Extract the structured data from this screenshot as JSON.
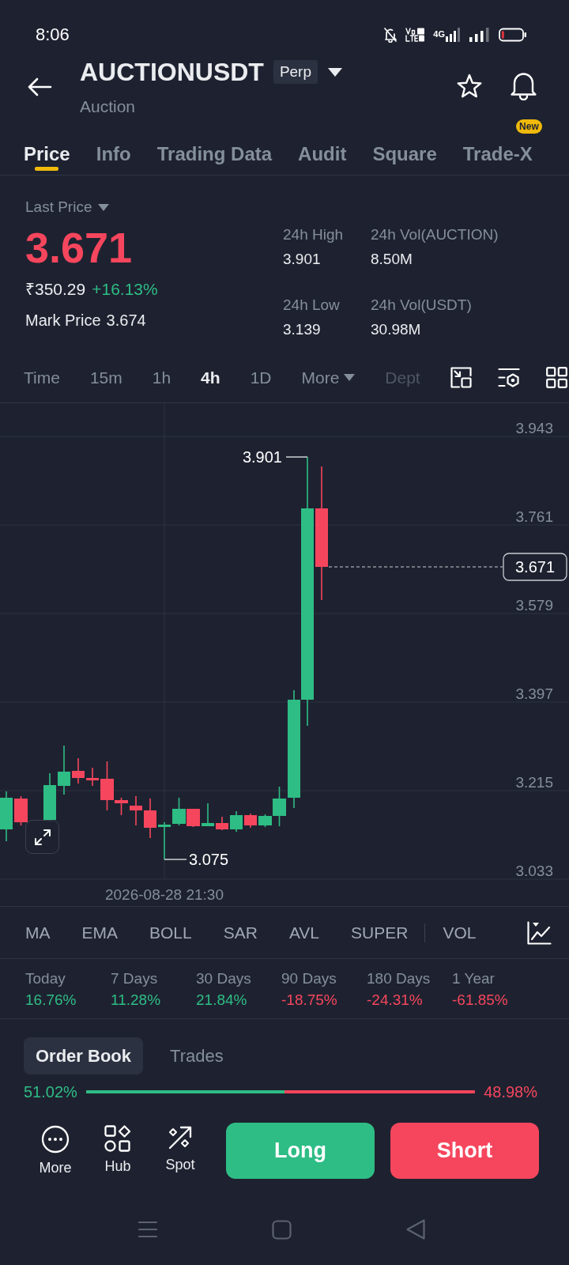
{
  "status_bar": {
    "time": "8:06",
    "network": "4G"
  },
  "header": {
    "symbol": "AUCTIONUSDT",
    "badge": "Perp",
    "subtitle": "Auction"
  },
  "tabs": [
    {
      "label": "Price",
      "selected": true
    },
    {
      "label": "Info",
      "selected": false
    },
    {
      "label": "Trading Data",
      "selected": false
    },
    {
      "label": "Audit",
      "selected": false
    },
    {
      "label": "Square",
      "selected": false
    },
    {
      "label": "Trade-X",
      "selected": false,
      "badge": "New"
    }
  ],
  "ticker": {
    "price_selector": "Last Price",
    "last_price": "3.671",
    "fiat_price": "₹350.29",
    "change": "+16.13%",
    "mark_label": "Mark Price",
    "mark_price": "3.674",
    "stats": [
      {
        "label": "24h High",
        "value": "3.901"
      },
      {
        "label": "24h Vol(AUCTION)",
        "value": "8.50M"
      },
      {
        "label": "24h Low",
        "value": "3.139"
      },
      {
        "label": "24h Vol(USDT)",
        "value": "30.98M"
      }
    ]
  },
  "intervals": [
    {
      "label": "Time",
      "selected": false,
      "kind": "interval"
    },
    {
      "label": "15m",
      "selected": false,
      "kind": "interval"
    },
    {
      "label": "1h",
      "selected": false,
      "kind": "interval"
    },
    {
      "label": "4h",
      "selected": true,
      "kind": "interval"
    },
    {
      "label": "1D",
      "selected": false,
      "kind": "interval"
    },
    {
      "label": "More",
      "selected": false,
      "kind": "dropdown"
    },
    {
      "label": "Dept",
      "selected": false,
      "kind": "tab"
    }
  ],
  "chart": {
    "y_axis": [
      "3.943",
      "3.761",
      "3.579",
      "3.397",
      "3.215",
      "3.033"
    ],
    "high_label": "3.901",
    "low_label": "3.075",
    "last_price_tag": "3.671",
    "time_label": "2026-08-28 21:30"
  },
  "indicators": {
    "main": [
      "MA",
      "EMA",
      "BOLL",
      "SAR",
      "AVL",
      "SUPER"
    ],
    "sub": [
      "VOL"
    ]
  },
  "returns": [
    {
      "period": "Today",
      "value": "16.76%",
      "color": "#2ebd85"
    },
    {
      "period": "7 Days",
      "value": "11.28%",
      "color": "#2ebd85"
    },
    {
      "period": "30 Days",
      "value": "21.84%",
      "color": "#2ebd85"
    },
    {
      "period": "90 Days",
      "value": "-18.75%",
      "color": "#f6465d"
    },
    {
      "period": "180 Days",
      "value": "-24.31%",
      "color": "#f6465d"
    },
    {
      "period": "1 Year",
      "value": "-61.85%",
      "color": "#f6465d"
    }
  ],
  "book_tabs": [
    {
      "label": "Order Book",
      "selected": true
    },
    {
      "label": "Trades",
      "selected": false
    }
  ],
  "book_ratio": {
    "bid": "51.02%",
    "ask": "48.98%",
    "level": 0.51
  },
  "actions": [
    {
      "label": "More"
    },
    {
      "label": "Hub"
    },
    {
      "label": "Spot"
    }
  ],
  "trade_buttons": [
    {
      "label": "Long",
      "kind": "long"
    },
    {
      "label": "Short",
      "kind": "short"
    }
  ]
}
